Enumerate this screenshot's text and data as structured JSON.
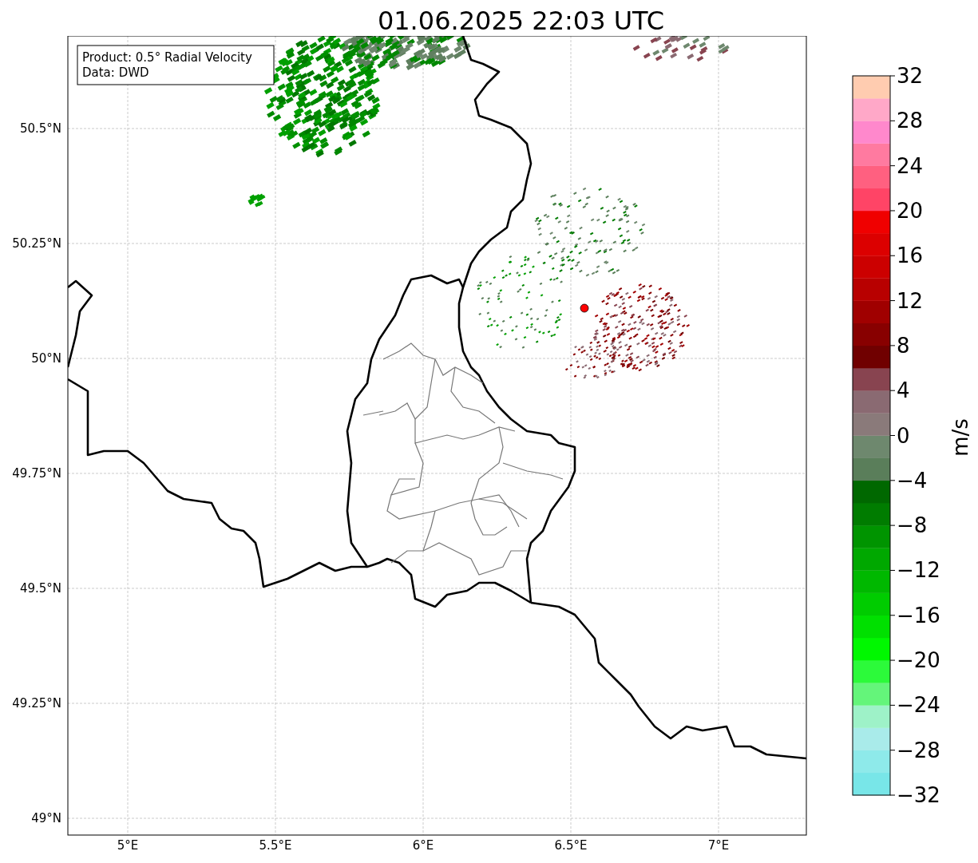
{
  "title": "01.06.2025 22:03 UTC",
  "info_box": {
    "lines": [
      "Product: 0.5° Radial Velocity",
      "Data: DWD"
    ]
  },
  "map": {
    "lat_labels": [
      "50.5°N",
      "50.25°N",
      "50°N",
      "49.75°N",
      "49.5°N",
      "49.25°N",
      "49°N"
    ],
    "lon_labels": [
      "5°E",
      "5.5°E",
      "6°E",
      "6.5°E",
      "7°E"
    ]
  },
  "colorbar": {
    "label": "m/s",
    "ticks": [
      "32",
      "28",
      "24",
      "20",
      "16",
      "12",
      "8",
      "4",
      "0",
      "−4",
      "−8",
      "−12",
      "−16",
      "−20",
      "−24",
      "−28",
      "−32"
    ],
    "bands": [
      {
        "color": "#78e6e8"
      },
      {
        "color": "#8eeaea"
      },
      {
        "color": "#a9ebea"
      },
      {
        "color": "#9ef2c8"
      },
      {
        "color": "#64f57a"
      },
      {
        "color": "#2cfa3a"
      },
      {
        "color": "#00f800"
      },
      {
        "color": "#00e000"
      },
      {
        "color": "#00cc00"
      },
      {
        "color": "#00b800"
      },
      {
        "color": "#00a800"
      },
      {
        "color": "#009400"
      },
      {
        "color": "#007c00"
      },
      {
        "color": "#006800"
      },
      {
        "color": "#5a7e5a"
      },
      {
        "color": "#6e886e"
      },
      {
        "color": "#8a7a7a"
      },
      {
        "color": "#8a6a72"
      },
      {
        "color": "#884450"
      },
      {
        "color": "#700000"
      },
      {
        "color": "#880000"
      },
      {
        "color": "#a00000"
      },
      {
        "color": "#b80000"
      },
      {
        "color": "#cc0000"
      },
      {
        "color": "#dc0000"
      },
      {
        "color": "#f00000"
      },
      {
        "color": "#ff4466"
      },
      {
        "color": "#ff6080"
      },
      {
        "color": "#ff7aa0"
      },
      {
        "color": "#ff88cc"
      },
      {
        "color": "#ffa8c8"
      },
      {
        "color": "#ffccb0"
      }
    ]
  }
}
